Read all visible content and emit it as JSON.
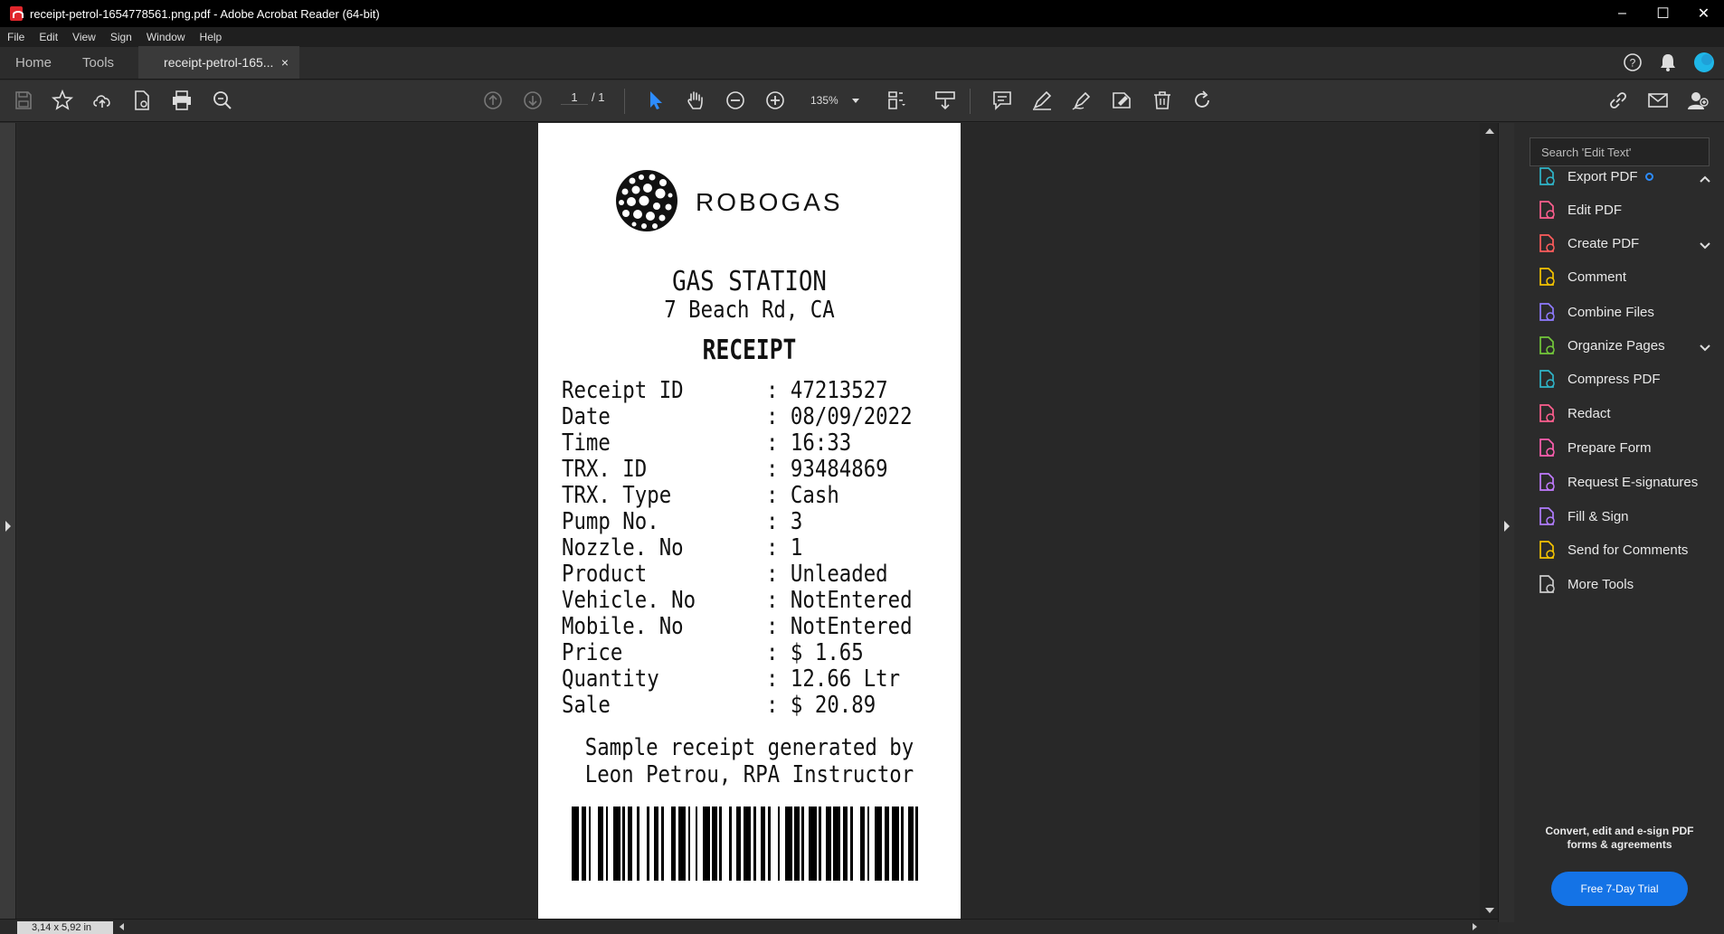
{
  "window": {
    "title": "receipt-petrol-1654778561.png.pdf - Adobe Acrobat Reader (64-bit)",
    "min": "–",
    "max": "☐",
    "close": "✕"
  },
  "menu": [
    "File",
    "Edit",
    "View",
    "Sign",
    "Window",
    "Help"
  ],
  "tabs": {
    "home": "Home",
    "tools": "Tools",
    "doc": "receipt-petrol-165...",
    "close": "×"
  },
  "toolbar": {
    "page_current": "1",
    "page_total": "/ 1",
    "zoom": "135%"
  },
  "status": {
    "page_size": "3,14 x 5,92 in"
  },
  "receipt": {
    "brand": "ROBOGAS",
    "heading": "GAS STATION",
    "address": "7 Beach Rd, CA",
    "title": "RECEIPT",
    "rows": [
      {
        "key": "Receipt ID",
        "value": "47213527"
      },
      {
        "key": "Date",
        "value": "08/09/2022"
      },
      {
        "key": "Time",
        "value": "16:33"
      },
      {
        "key": "TRX. ID",
        "value": "93484869"
      },
      {
        "key": "TRX. Type",
        "value": "Cash"
      },
      {
        "key": "Pump No.",
        "value": "3"
      },
      {
        "key": "Nozzle. No",
        "value": "1"
      },
      {
        "key": "Product",
        "value": "Unleaded"
      },
      {
        "key": "Vehicle. No",
        "value": "NotEntered"
      },
      {
        "key": "Mobile. No",
        "value": "NotEntered"
      },
      {
        "key": "Price",
        "value": "$ 1.65"
      },
      {
        "key": "Quantity",
        "value": "12.66 Ltr"
      },
      {
        "key": "Sale",
        "value": "$ 20.89"
      }
    ],
    "footer_line1": "Sample receipt generated by",
    "footer_line2": "Leon Petrou, RPA Instructor"
  },
  "rightpanel": {
    "search_placeholder": "Search 'Edit Text'",
    "tools": [
      {
        "label": "Export PDF",
        "icon": "export-pdf-icon",
        "color": "#2fb5c9"
      },
      {
        "label": "Edit PDF",
        "icon": "edit-pdf-icon",
        "color": "#ff5f8f"
      },
      {
        "label": "Create PDF",
        "icon": "create-pdf-icon",
        "color": "#ff5c5c"
      },
      {
        "label": "Comment",
        "icon": "comment-icon",
        "color": "#f5c400"
      },
      {
        "label": "Combine Files",
        "icon": "combine-files-icon",
        "color": "#8f7bff"
      },
      {
        "label": "Organize Pages",
        "icon": "organize-pages-icon",
        "color": "#73c83a"
      },
      {
        "label": "Compress PDF",
        "icon": "compress-pdf-icon",
        "color": "#2fb5c9"
      },
      {
        "label": "Redact",
        "icon": "redact-icon",
        "color": "#ff5f8f"
      },
      {
        "label": "Prepare Form",
        "icon": "prepare-form-icon",
        "color": "#ff5fb0"
      },
      {
        "label": "Request E-signatures",
        "icon": "request-esignatures-icon",
        "color": "#c17bff"
      },
      {
        "label": "Fill & Sign",
        "icon": "fill-sign-icon",
        "color": "#b07cff"
      },
      {
        "label": "Send for Comments",
        "icon": "send-for-comments-icon",
        "color": "#f5c400"
      },
      {
        "label": "More Tools",
        "icon": "more-tools-icon",
        "color": "#cccccc"
      }
    ],
    "promo": "Convert, edit and e-sign PDF forms & agreements",
    "trial_button": "Free 7-Day Trial"
  },
  "colors": {
    "accent": "#1473e6",
    "page_bg": "#ffffff",
    "viewer_bg": "#282828"
  }
}
